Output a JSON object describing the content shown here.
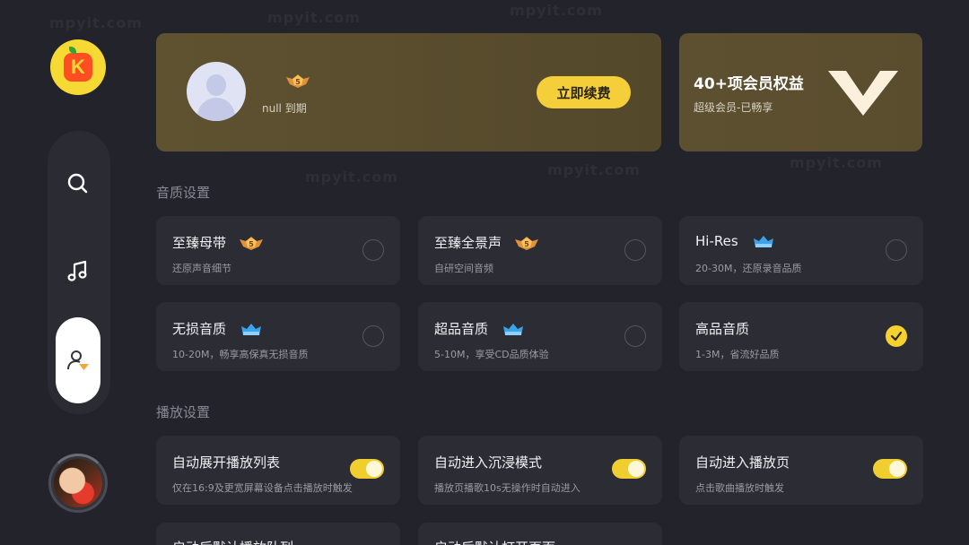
{
  "app": {
    "logo_letter": "K"
  },
  "nav": {
    "items": [
      {
        "name": "search",
        "icon": "search-icon"
      },
      {
        "name": "music",
        "icon": "music-note-icon"
      },
      {
        "name": "profile",
        "icon": "user-vip-icon",
        "active": true
      }
    ]
  },
  "vip": {
    "expire_text": "null 到期",
    "level_badge": "5",
    "renew_label": "立即续费",
    "benefits_title": "40+项会员权益",
    "benefits_sub": "超级会员-已畅享"
  },
  "sections": {
    "quality_title": "音质设置",
    "playback_title": "播放设置"
  },
  "quality_options": [
    {
      "title": "至臻母带",
      "sub": "还原声音细节",
      "badge": "vip5-badge",
      "selected": false
    },
    {
      "title": "至臻全景声",
      "sub": "自研空间音频",
      "badge": "vip5-badge",
      "selected": false
    },
    {
      "title": "Hi-Res",
      "sub": "20-30M，还原录音品质",
      "badge": "svip-crown-badge",
      "selected": false
    },
    {
      "title": "无损音质",
      "sub": "10-20M，畅享高保真无损音质",
      "badge": "svip-crown-badge",
      "selected": false
    },
    {
      "title": "超品音质",
      "sub": "5-10M，享受CD品质体验",
      "badge": "svip-crown-badge",
      "selected": false
    },
    {
      "title": "高品音质",
      "sub": "1-3M，省流好品质",
      "badge": "",
      "selected": true
    }
  ],
  "playback_options": [
    {
      "title": "自动展开播放列表",
      "sub": "仅在16:9及更宽屏幕设备点击播放时触发",
      "on": true
    },
    {
      "title": "自动进入沉浸模式",
      "sub": "播放页播歌10s无操作时自动进入",
      "on": true
    },
    {
      "title": "自动进入播放页",
      "sub": "点击歌曲播放时触发",
      "on": true
    },
    {
      "title": "启动后默认播放队列",
      "sub": ""
    },
    {
      "title": "启动后默认打开页面",
      "sub": ""
    }
  ],
  "colors": {
    "background": "#23232b",
    "card": "#2c2c35",
    "accent": "#f4cf3a",
    "vip_card": "#5f5231"
  },
  "watermark_text": "mpyit.com"
}
